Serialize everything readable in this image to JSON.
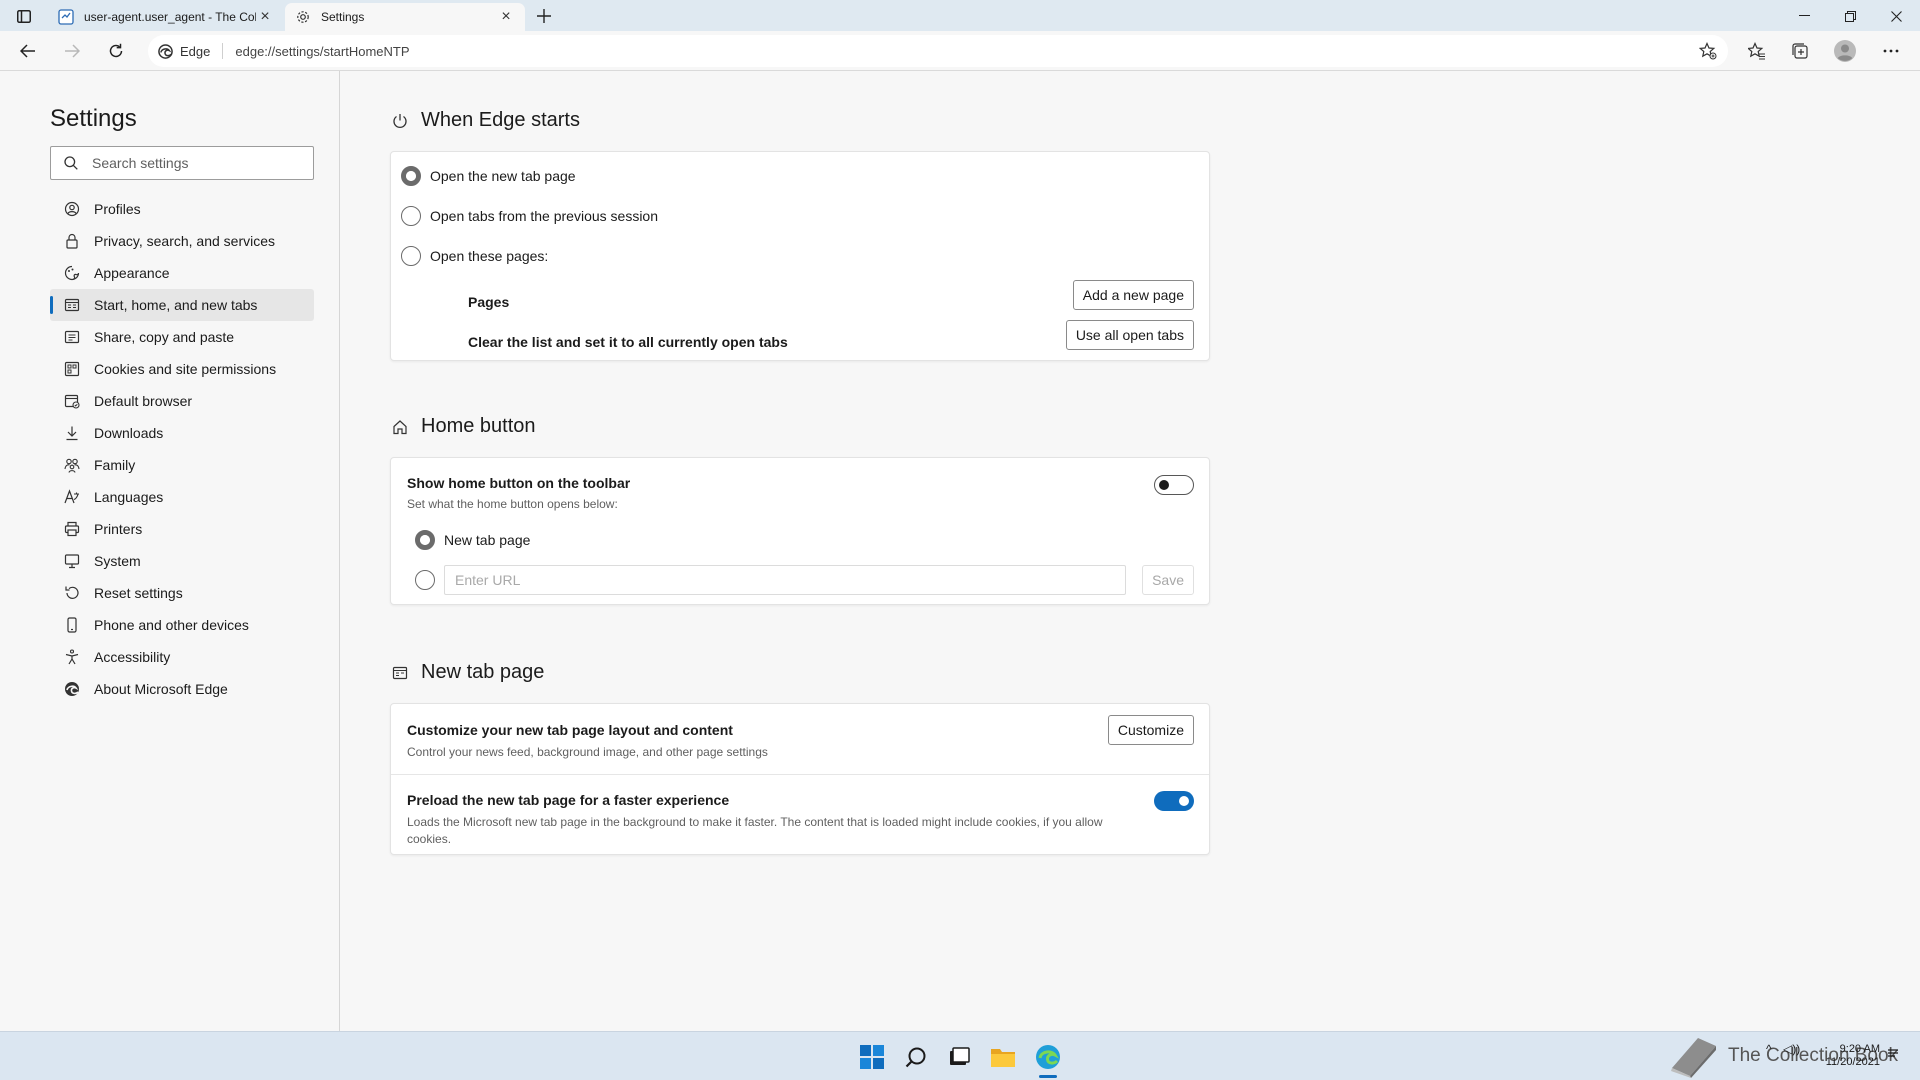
{
  "browser": {
    "tabs": [
      {
        "title": "user-agent.user_agent - The Coll",
        "active": false
      },
      {
        "title": "Settings",
        "active": true
      }
    ],
    "brand": "Edge",
    "url": "edge://settings/startHomeNTP"
  },
  "sidebar": {
    "title": "Settings",
    "search_placeholder": "Search settings",
    "items": [
      {
        "label": "Profiles",
        "icon": "profile-icon"
      },
      {
        "label": "Privacy, search, and services",
        "icon": "lock-icon"
      },
      {
        "label": "Appearance",
        "icon": "appearance-icon"
      },
      {
        "label": "Start, home, and new tabs",
        "icon": "start-icon",
        "selected": true
      },
      {
        "label": "Share, copy and paste",
        "icon": "share-icon"
      },
      {
        "label": "Cookies and site permissions",
        "icon": "cookies-icon"
      },
      {
        "label": "Default browser",
        "icon": "browser-icon"
      },
      {
        "label": "Downloads",
        "icon": "download-icon"
      },
      {
        "label": "Family",
        "icon": "family-icon"
      },
      {
        "label": "Languages",
        "icon": "languages-icon"
      },
      {
        "label": "Printers",
        "icon": "printer-icon"
      },
      {
        "label": "System",
        "icon": "system-icon"
      },
      {
        "label": "Reset settings",
        "icon": "reset-icon"
      },
      {
        "label": "Phone and other devices",
        "icon": "phone-icon"
      },
      {
        "label": "Accessibility",
        "icon": "accessibility-icon"
      },
      {
        "label": "About Microsoft Edge",
        "icon": "edge-icon"
      }
    ]
  },
  "when_edge_starts": {
    "heading": "When Edge starts",
    "options": [
      "Open the new tab page",
      "Open tabs from the previous session",
      "Open these pages:"
    ],
    "selected_option": 0,
    "pages_label": "Pages",
    "add_page_button": "Add a new page",
    "clear_label": "Clear the list and set it to all currently open tabs",
    "use_open_tabs_button": "Use all open tabs"
  },
  "home_button": {
    "heading": "Home button",
    "toggle_title": "Show home button on the toolbar",
    "toggle_desc": "Set what the home button opens below:",
    "toggle_on": false,
    "option_new_tab": "New tab page",
    "url_placeholder": "Enter URL",
    "save_button": "Save"
  },
  "new_tab_page": {
    "heading": "New tab page",
    "customize_title": "Customize your new tab page layout and content",
    "customize_desc": "Control your news feed, background image, and other page settings",
    "customize_button": "Customize",
    "preload_title": "Preload the new tab page for a faster experience",
    "preload_desc": "Loads the Microsoft new tab page in the background to make it faster. The content that is loaded might include cookies, if you allow cookies.",
    "preload_on": true
  },
  "taskbar": {
    "time": "9:20 AM",
    "date": "11/20/2021",
    "watermark": "The Collection Book"
  },
  "colors": {
    "accent": "#0f6cbd",
    "titlebar": "#dfe9f1",
    "taskbar": "#dbe6f1"
  }
}
